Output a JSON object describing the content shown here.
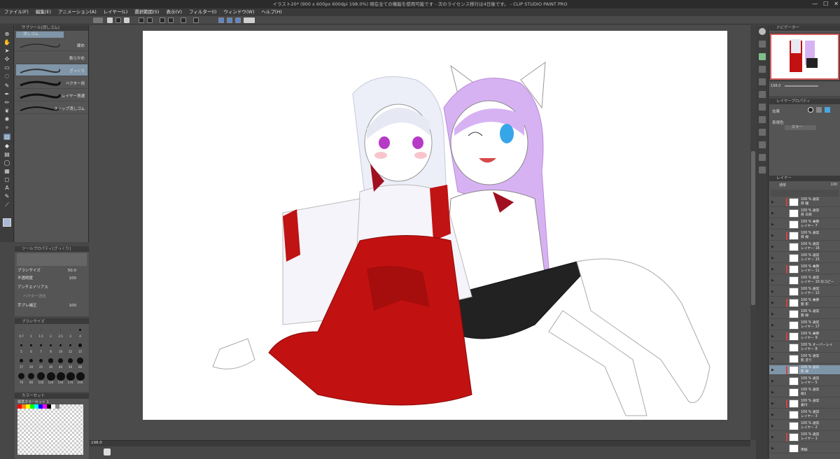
{
  "window": {
    "title": "イラスト20* (900 x 600px 600dpi 198.0%)  現在全ての機能を使用可能です - 次のライセンス移行は4日後です。 - CLIP STUDIO PAINT PRO",
    "controls": [
      "—",
      "☐",
      "✕"
    ]
  },
  "menu": [
    "ファイル(F)",
    "編集(E)",
    "アニメーション(A)",
    "レイヤー(L)",
    "選択範囲(S)",
    "表示(V)",
    "フィルター(I)",
    "ウィンドウ(W)",
    "ヘルプ(H)"
  ],
  "subtool_panel": {
    "header": "サブツール[消しゴム]",
    "group": "消しゴム",
    "brushes": [
      {
        "label": "硬め"
      },
      {
        "label": "軟らかめ"
      },
      {
        "label": "ざっくり",
        "selected": true
      },
      {
        "label": "ベクター用"
      },
      {
        "label": "レイヤー貫通"
      },
      {
        "label": "スナップ消しゴム"
      }
    ]
  },
  "tool_property": {
    "header": "ツールプロパティ[ざっくり]",
    "rows": [
      {
        "label": "ブラシサイズ",
        "value": "50.0"
      },
      {
        "label": "不透明度",
        "value": "100"
      },
      {
        "label": "アンチエイリアス",
        "value": ""
      },
      {
        "label": "ベクター消去",
        "value": ""
      },
      {
        "label": "手ブレ補正",
        "value": "100"
      }
    ]
  },
  "brush_size": {
    "header": "ブラシサイズ",
    "sizes": [
      "0.7",
      "1",
      "1.5",
      "2",
      "2.5",
      "3",
      "4",
      "5",
      "6",
      "7",
      "8",
      "10",
      "12",
      "15",
      "17",
      "20",
      "25",
      "30",
      "40",
      "50",
      "60",
      "70",
      "80",
      "100",
      "120",
      "150",
      "170",
      "200"
    ]
  },
  "color_set": {
    "header": "カラーセット",
    "name": "標準カラーセット 1"
  },
  "canvas": {
    "zoom": "198.0"
  },
  "navigator": {
    "header": "ナビゲーター",
    "zoom": "198.0"
  },
  "layer_property": {
    "header": "レイヤープロパティ",
    "effect_label": "効果",
    "color_label": "表現色",
    "color_value": "カラー"
  },
  "layer_panel": {
    "header": "レイヤー",
    "blend": "通常",
    "opacity": "100",
    "layers": [
      {
        "title": "100 % 通常",
        "name": "目 瞳",
        "sel": false
      },
      {
        "title": "100 % 通常",
        "name": "目 白目",
        "sel": false
      },
      {
        "title": "100 % 乗算",
        "name": "レイヤー 7",
        "sel": false
      },
      {
        "title": "100 % 通常",
        "name": "目 線",
        "sel": false
      },
      {
        "title": "100 % 通常",
        "name": "レイヤー 16",
        "sel": false
      },
      {
        "title": "100 % 通常",
        "name": "レイヤー 15",
        "sel": false
      },
      {
        "title": "100 % 乗算",
        "name": "レイヤー 11",
        "sel": false
      },
      {
        "title": "100 % 通常",
        "name": "レイヤー 10 のコピー",
        "sel": false
      },
      {
        "title": "100 % 通常",
        "name": "レイヤー 12",
        "sel": false
      },
      {
        "title": "100 % 乗算",
        "name": "髪 影",
        "sel": false
      },
      {
        "title": "100 % 通常",
        "name": "髪 線",
        "sel": false
      },
      {
        "title": "100 % 通常",
        "name": "レイヤー 17",
        "sel": false
      },
      {
        "title": "100 % 乗算",
        "name": "レイヤー 9",
        "sel": false
      },
      {
        "title": "100 % オーバーレイ",
        "name": "レイヤー 8",
        "sel": false
      },
      {
        "title": "100 % 通常",
        "name": "肌 塗り",
        "sel": false
      },
      {
        "title": "100 % 通常",
        "name": "肌 線",
        "sel": true
      },
      {
        "title": "100 % 通常",
        "name": "レイヤー 5",
        "sel": false
      },
      {
        "title": "100 % 通常",
        "name": "線1",
        "sel": false
      },
      {
        "title": "100 % 通常",
        "name": "着付",
        "sel": false
      },
      {
        "title": "100 % 通常",
        "name": "レイヤー 3",
        "sel": false
      },
      {
        "title": "100 % 通常",
        "name": "レイヤー 2",
        "sel": false
      },
      {
        "title": "100 % 通常",
        "name": "レイヤー 1",
        "sel": false
      },
      {
        "title": "",
        "name": "用紙",
        "sel": false
      }
    ]
  },
  "colors": {
    "accent": "#7f95a8",
    "canvas_bg": "#ffffff",
    "ui_dark": "#3a3a3a",
    "ui_mid": "#555555"
  },
  "icons": [
    "cursor-icon",
    "hand-icon",
    "zoom-icon",
    "pen-icon",
    "brush-icon",
    "eraser-icon",
    "fill-icon",
    "text-icon",
    "eyedropper-icon",
    "gradient-icon"
  ]
}
